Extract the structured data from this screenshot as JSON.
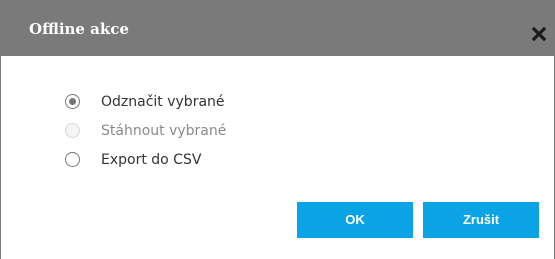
{
  "dialog": {
    "title": "Offline akce",
    "close_icon": "close-x-icon"
  },
  "options": [
    {
      "label": "Odznačit vybrané",
      "state": "checked",
      "enabled": true
    },
    {
      "label": "Stáhnout vybrané",
      "state": "unchecked",
      "enabled": false
    },
    {
      "label": "Export do CSV",
      "state": "unchecked",
      "enabled": true
    }
  ],
  "buttons": {
    "ok_label": "OK",
    "cancel_label": "Zrušit"
  },
  "colors": {
    "titlebar": "#7a7a7a",
    "button": "#0aa3e6",
    "title_text": "#ffffff"
  }
}
